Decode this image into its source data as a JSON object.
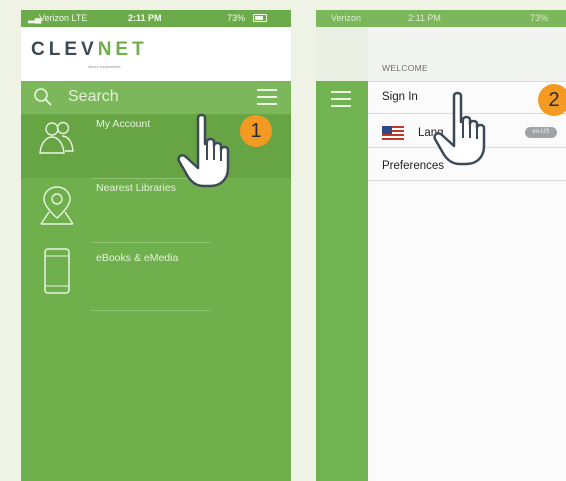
{
  "left_phone": {
    "status": {
      "carrier": "Verizon  LTE",
      "time": "2:11 PM",
      "battery": "73%"
    },
    "logo": {
      "part1": "CLEV",
      "part2": "NET",
      "tagline": "library cooperative"
    },
    "search": {
      "label": "Search"
    },
    "menu": [
      {
        "label": "My Account",
        "icon": "people-icon"
      },
      {
        "label": "Nearest Libraries",
        "icon": "map-pin-icon"
      },
      {
        "label": "eBooks & eMedia",
        "icon": "phone-icon"
      }
    ]
  },
  "right_phone": {
    "status": {
      "carrier": "Verizon",
      "time": "2:11 PM",
      "battery": "73%"
    },
    "drawer": {
      "section_title": "WELCOME",
      "sign_in": "Sign In",
      "language_label": "Lang",
      "language_value": "en-US",
      "preferences": "Preferences"
    }
  },
  "step_badges": [
    "1",
    "2"
  ],
  "colors": {
    "green": "#6faf4c",
    "orange": "#f49a22",
    "logo_dark": "#3c4a57"
  }
}
